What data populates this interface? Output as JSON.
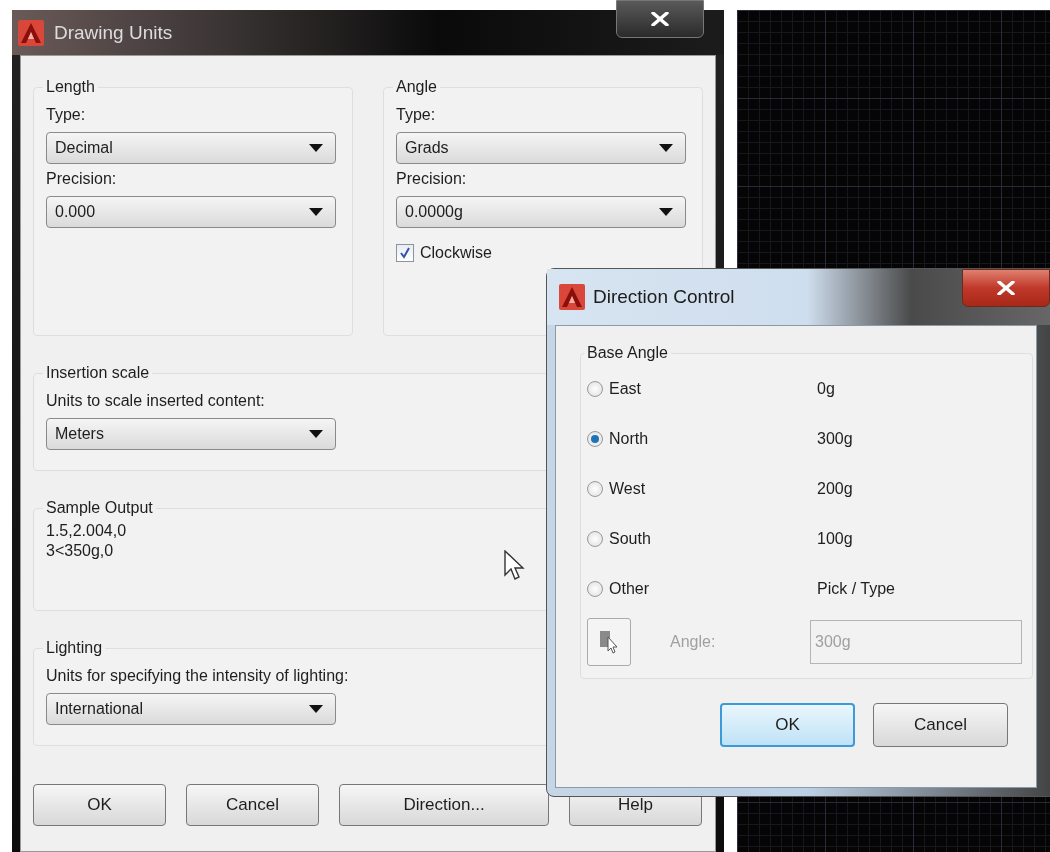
{
  "drawing_units": {
    "title": "Drawing Units",
    "length": {
      "label": "Length",
      "type_label": "Type:",
      "type_value": "Decimal",
      "precision_label": "Precision:",
      "precision_value": "0.000"
    },
    "angle": {
      "label": "Angle",
      "type_label": "Type:",
      "type_value": "Grads",
      "precision_label": "Precision:",
      "precision_value": "0.0000g",
      "clockwise": {
        "label": "Clockwise",
        "checked": true
      }
    },
    "insertion_scale": {
      "label": "Insertion scale",
      "field_label": "Units to scale inserted content:",
      "value": "Meters"
    },
    "sample_output": {
      "label": "Sample Output",
      "lines": [
        "1.5,2.004,0",
        "3<350g,0"
      ]
    },
    "lighting": {
      "label": "Lighting",
      "field_label": "Units for specifying the intensity of lighting:",
      "value": "International"
    },
    "buttons": [
      "OK",
      "Cancel",
      "Direction...",
      "Help"
    ]
  },
  "direction_control": {
    "title": "Direction Control",
    "base_angle": {
      "label": "Base Angle",
      "options": [
        {
          "label": "East",
          "value": "0g",
          "selected": false
        },
        {
          "label": "North",
          "value": "300g",
          "selected": true
        },
        {
          "label": "West",
          "value": "200g",
          "selected": false
        },
        {
          "label": "South",
          "value": "100g",
          "selected": false
        },
        {
          "label": "Other",
          "value": "Pick / Type",
          "selected": false
        }
      ]
    },
    "angle": {
      "label": "Angle:",
      "value": "300g",
      "disabled": true
    },
    "buttons": [
      {
        "label": "OK",
        "focused": true
      },
      {
        "label": "Cancel",
        "focused": false
      }
    ]
  }
}
